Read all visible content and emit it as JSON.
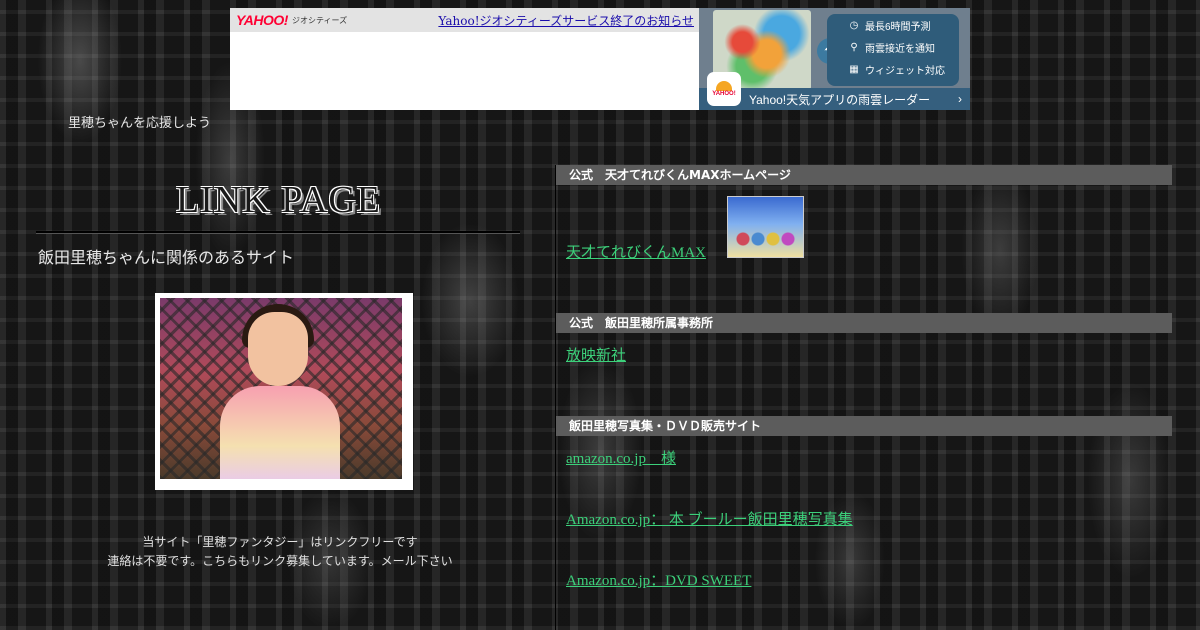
{
  "banner": {
    "logo_main": "YAHOO!",
    "logo_sub": "ジオシティーズ",
    "notice_link": "Yahoo!ジオシティーズサービス終了のお知らせ"
  },
  "weather_ad": {
    "features": [
      {
        "icon": "clock-icon",
        "label": "最長6時間予測"
      },
      {
        "icon": "pin-icon",
        "label": "雨雲接近を通知"
      },
      {
        "icon": "widget-icon",
        "label": "ウィジェット対応"
      }
    ],
    "footer_label": "Yahoo!天気アプリの雨雲レーダー",
    "arrow": "›",
    "app_icon_label": "YAHOO!"
  },
  "left": {
    "tagline": "里穂ちゃんを応援しよう",
    "page_title": "LINK PAGE",
    "subtitle": "飯田里穂ちゃんに関係のあるサイト",
    "footer_line1": "当サイト「里穂ファンタジー」はリンクフリーです",
    "footer_line2": "連絡は不要です。こちらもリンク募集しています。メール下さい"
  },
  "sections": [
    {
      "header": "公式　天才てれびくんMAXホームページ",
      "links": [
        "天才てれびくんMAX"
      ]
    },
    {
      "header": "公式　飯田里穂所属事務所",
      "links": [
        "放映新社"
      ]
    },
    {
      "header": "飯田里穂写真集・ＤＶＤ販売サイト",
      "links": [
        "amazon.co.jp　様",
        "Amazon.co.jp： 本 ブールー飯田里穂写真集",
        "Amazon.co.jp：DVD SWEET"
      ]
    }
  ],
  "colors": {
    "link": "#3cd07a",
    "section_header_bg": "#5c5c5c",
    "yahoo_red": "#ff0033"
  }
}
